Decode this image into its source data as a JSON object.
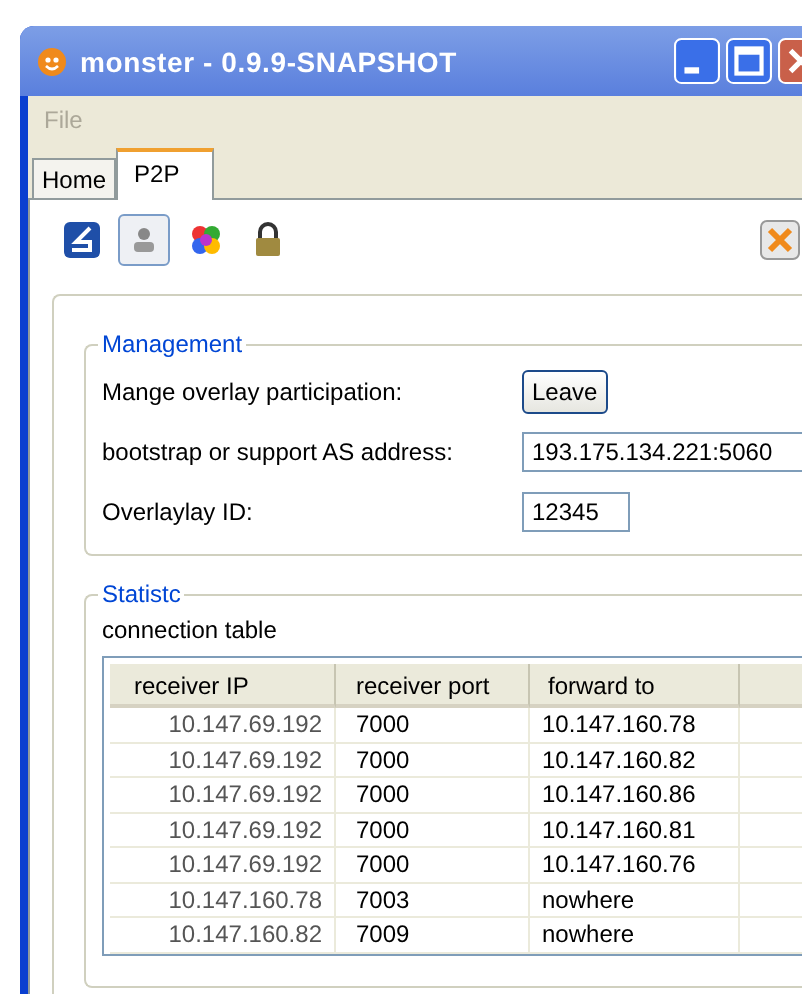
{
  "window": {
    "title": "monster - 0.9.9-SNAPSHOT"
  },
  "menu": [
    {
      "label": "File",
      "disabled": true
    }
  ],
  "tabs": [
    {
      "label": "Home",
      "selected": false
    },
    {
      "label": "P2P",
      "selected": true
    }
  ],
  "toolbar": [
    {
      "kind": "back",
      "selected": false
    },
    {
      "kind": "user",
      "selected": true
    },
    {
      "kind": "puzzle",
      "selected": false
    },
    {
      "kind": "lock",
      "selected": false
    }
  ],
  "management": {
    "title": "Management",
    "rows": [
      {
        "kind": "button",
        "label": "Mange overlay participation:",
        "value": "Leave"
      },
      {
        "kind": "field",
        "label": "bootstrap or support AS address:",
        "value": "193.175.134.221:5060"
      },
      {
        "kind": "field",
        "label": "Overlaylay ID:",
        "value": "12345"
      }
    ]
  },
  "statistic": {
    "title": "Statistc",
    "caption": "connection table",
    "table": {
      "columns": [
        "receiver IP",
        "receiver port",
        "forward to"
      ],
      "rows": [
        [
          "10.147.69.192",
          "7000",
          "10.147.160.78"
        ],
        [
          "10.147.69.192",
          "7000",
          "10.147.160.82"
        ],
        [
          "10.147.69.192",
          "7000",
          "10.147.160.86"
        ],
        [
          "10.147.69.192",
          "7000",
          "10.147.160.81"
        ],
        [
          "10.147.69.192",
          "7000",
          "10.147.160.76"
        ],
        [
          "10.147.160.78",
          "7003",
          "nowhere"
        ],
        [
          "10.147.160.82",
          "7009",
          "nowhere"
        ]
      ]
    }
  }
}
